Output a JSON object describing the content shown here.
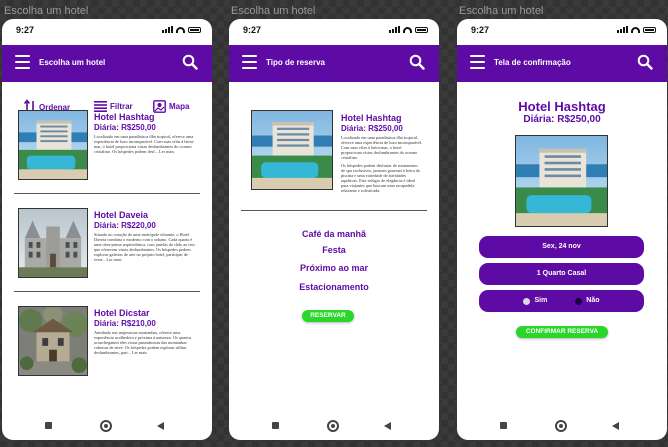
{
  "frame_title": "Escolha um hotel",
  "status_time": "9:27",
  "colors": {
    "brand": "#5e0aa5",
    "accent_green": "#2bd62b"
  },
  "screen1": {
    "title": "Escolha um hotel",
    "filters": {
      "sort": "Ordenar",
      "filter": "Filtrar",
      "map": "Mapa"
    },
    "hotels": [
      {
        "name": "Hotel Hashtag",
        "price": "Diária: R$250,00",
        "desc": "Localizado em uma paradisíaca ilha tropical, oferece uma experiência de luxo incomparável. Com suas vilas à beira-mar, o hotel proporciona vistas deslumbrantes do oceano cristalino. Os hóspedes podem desf... Ler mais"
      },
      {
        "name": "Hotel Daveia",
        "price": "Diária: R$220,00",
        "desc": "Situado no coração de uma metrópole vibrante, o Hotel Daveia combina o moderno com o urbano. Cada quarto é uma obra-prima arquitetônica, com janelas do chão ao teto que oferecem vistas deslumbrantes. Os hóspedes podem explorar galerias de arte no próprio hotel, participar de even... Ler mais"
      },
      {
        "name": "Hotel Dicstar",
        "price": "Diária: R$210,00",
        "desc": "Aninhado nas majestosas montanhas, oferece uma experiência acolhedora e próxima à natureza. Os quartos aconchegantes têm vistas panorâmicas das montanhas cobertas de neve. Os hóspedes podem explorar trilhas deslumbrantes, part... Ler mais"
      }
    ]
  },
  "screen2": {
    "title": "Tipo de reserva",
    "hotel_name": "Hotel Hashtag",
    "hotel_price": "Diária: R$250,00",
    "desc1": "Localizado em uma paradisíaca ilha tropical, oferece uma experiência de luxo incomparável. Com suas vilas à beira-mar, o hotel proporciona vistas deslumbrantes do oceano cristalino.",
    "desc2": "Os hóspedes podem desfrutar de tratamentos de spa exclusivos, jantares gourmet à beira da piscina e uma variedade de atividades aquáticas. Este refúgio de elegância é ideal para viajantes que buscam uma escapadela relaxante e sofisticada.",
    "options": [
      "Café da manhã",
      "Festa",
      "Próximo ao mar",
      "Estacionamento"
    ],
    "button": "RESERVAR"
  },
  "screen3": {
    "title": "Tela de confirmação",
    "hotel_name": "Hotel Hashtag",
    "hotel_price": "Diária: R$250,00",
    "date": "Sex, 24 nov",
    "room": "1 Quarto Casal",
    "yes": "Sim",
    "no": "Não",
    "button": "CONFIRMAR RESERVA"
  }
}
